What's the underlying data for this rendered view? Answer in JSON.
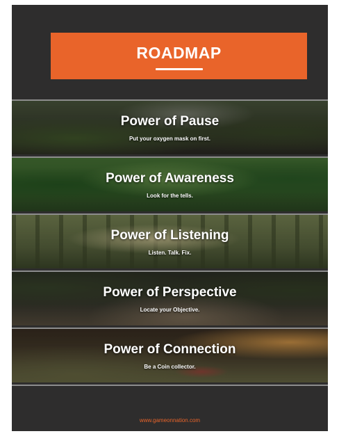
{
  "header": {
    "title": "ROADMAP"
  },
  "sections": [
    {
      "title": "Power of Pause",
      "subtitle": "Put your oxygen mask on first."
    },
    {
      "title": "Power of Awareness",
      "subtitle": "Look for the tells."
    },
    {
      "title": "Power of Listening",
      "subtitle": "Listen. Talk. Fix."
    },
    {
      "title": "Power of Perspective",
      "subtitle": "Locate your Objective."
    },
    {
      "title": "Power of Connection",
      "subtitle": "Be a Coin collector."
    }
  ],
  "footer": {
    "url": "www.gameonnation.com"
  },
  "colors": {
    "accent": "#e9642a",
    "background": "#2e2d2d"
  }
}
